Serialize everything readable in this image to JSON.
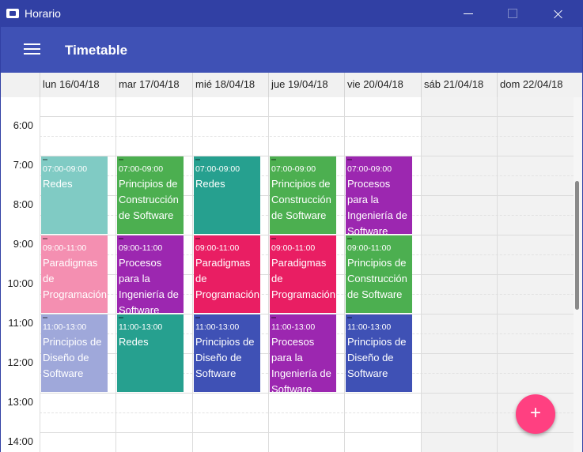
{
  "window": {
    "title": "Horario"
  },
  "appbar": {
    "title": "Timetable"
  },
  "days": [
    {
      "label": "lun 16/04/18",
      "weekend": false
    },
    {
      "label": "mar 17/04/18",
      "weekend": false
    },
    {
      "label": "mié 18/04/18",
      "weekend": false
    },
    {
      "label": "jue 19/04/18",
      "weekend": false
    },
    {
      "label": "vie 20/04/18",
      "weekend": false
    },
    {
      "label": "sáb 21/04/18",
      "weekend": true
    },
    {
      "label": "dom 22/04/18",
      "weekend": true
    }
  ],
  "times": [
    "6:00",
    "7:00",
    "8:00",
    "9:00",
    "10:00",
    "11:00",
    "12:00",
    "13:00",
    "14:00"
  ],
  "events": [
    {
      "day": 0,
      "start": 7,
      "end": 9,
      "time": "07:00-09:00",
      "title": "Redes",
      "color": "#80cbc4"
    },
    {
      "day": 0,
      "start": 9,
      "end": 11,
      "time": "09:00-11:00",
      "title": "Paradigmas de Programación",
      "color": "#f48fb1"
    },
    {
      "day": 0,
      "start": 11,
      "end": 13,
      "time": "11:00-13:00",
      "title": "Principios de Diseño de Software",
      "color": "#9fa8da"
    },
    {
      "day": 1,
      "start": 7,
      "end": 9,
      "time": "07:00-09:00",
      "title": "Principios de Construcción de Software",
      "color": "#4caf50"
    },
    {
      "day": 1,
      "start": 9,
      "end": 11,
      "time": "09:00-11:00",
      "title": "Procesos para la Ingeniería de Software",
      "color": "#9c27b0"
    },
    {
      "day": 1,
      "start": 11,
      "end": 13,
      "time": "11:00-13:00",
      "title": "Redes",
      "color": "#26a08f"
    },
    {
      "day": 2,
      "start": 7,
      "end": 9,
      "time": "07:00-09:00",
      "title": "Redes",
      "color": "#26a08f"
    },
    {
      "day": 2,
      "start": 9,
      "end": 11,
      "time": "09:00-11:00",
      "title": "Paradigmas de Programación",
      "color": "#e91e63"
    },
    {
      "day": 2,
      "start": 11,
      "end": 13,
      "time": "11:00-13:00",
      "title": "Principios de Diseño de Software",
      "color": "#3f51b5"
    },
    {
      "day": 3,
      "start": 7,
      "end": 9,
      "time": "07:00-09:00",
      "title": "Principios de Construcción de Software",
      "color": "#4caf50"
    },
    {
      "day": 3,
      "start": 9,
      "end": 11,
      "time": "09:00-11:00",
      "title": "Paradigmas de Programación",
      "color": "#e91e63"
    },
    {
      "day": 3,
      "start": 11,
      "end": 13,
      "time": "11:00-13:00",
      "title": "Procesos para la Ingeniería de Software",
      "color": "#9c27b0"
    },
    {
      "day": 4,
      "start": 7,
      "end": 9,
      "time": "07:00-09:00",
      "title": "Procesos para la Ingeniería de Software",
      "color": "#9c27b0"
    },
    {
      "day": 4,
      "start": 9,
      "end": 11,
      "time": "09:00-11:00",
      "title": "Principios de Construcción de Software",
      "color": "#4caf50"
    },
    {
      "day": 4,
      "start": 11,
      "end": 13,
      "time": "11:00-13:00",
      "title": "Principios de Diseño de Software",
      "color": "#3f51b5"
    }
  ],
  "fab": {
    "label": "+"
  },
  "icons": {
    "app": "app-icon",
    "menu": "hamburger-menu-icon",
    "minimize": "minimize-icon",
    "maximize": "maximize-icon",
    "close": "close-icon"
  }
}
